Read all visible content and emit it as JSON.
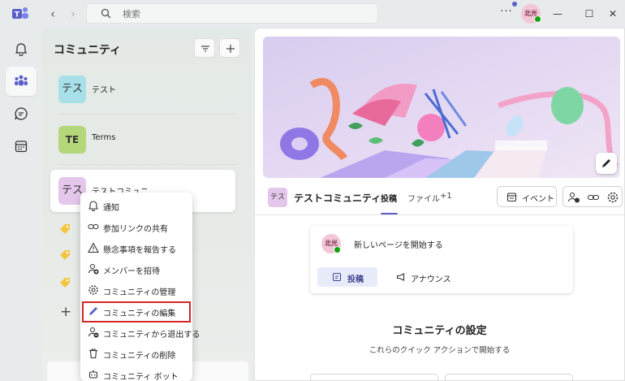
{
  "titlebar": {
    "search_placeholder": "検索",
    "user_initials": "北光"
  },
  "panel": {
    "title": "コミュニティ",
    "communities": [
      {
        "avatar_text": "テス",
        "name": "テスト",
        "avatar_color": "#a8e0ea"
      },
      {
        "avatar_text": "TE",
        "name": "Terms",
        "avatar_color": "#b4d77a"
      },
      {
        "avatar_text": "テス",
        "name": "テストコミュニティ",
        "avatar_color": "#e5c7ec"
      }
    ]
  },
  "context_menu": {
    "items": [
      {
        "label": "通知",
        "icon": "bell-icon"
      },
      {
        "label": "参加リンクの共有",
        "icon": "link-icon"
      },
      {
        "label": "懸念事項を報告する",
        "icon": "warning-icon"
      },
      {
        "label": "メンバーを招待",
        "icon": "add-person-icon"
      },
      {
        "label": "コミュニティの管理",
        "icon": "gear-icon"
      },
      {
        "label": "コミュニティの編集",
        "icon": "pencil-icon"
      },
      {
        "label": "コミュニティから退出する",
        "icon": "leave-person-icon"
      },
      {
        "label": "コミュニティの削除",
        "icon": "trash-icon"
      },
      {
        "label": "コミュニティ ボット",
        "icon": "bot-icon"
      }
    ]
  },
  "main": {
    "header": {
      "avatar_text": "テス",
      "community_name": "テストコミュニティ",
      "tabs": [
        "投稿",
        "ファイル",
        "+1"
      ],
      "event_label": "イベント"
    },
    "composer": {
      "user_initials": "北光",
      "prompt": "新しいページを開始する",
      "post_label": "投稿",
      "announce_label": "アナウンス"
    },
    "settings": {
      "title": "コミュニティの設定",
      "subtitle": "これらのクイック アクションで開始する"
    }
  },
  "colors": {
    "accent": "#5b5fc7",
    "highlight_border": "#d42525",
    "presence": "#13a10e"
  }
}
